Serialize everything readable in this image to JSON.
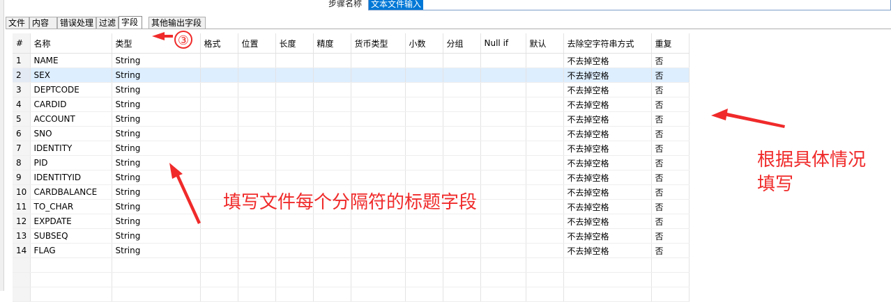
{
  "step": {
    "label": "步骤名称",
    "value": "文本文件输入"
  },
  "tabs": [
    "文件",
    "内容",
    "错误处理",
    "过滤",
    "字段",
    "其他输出字段"
  ],
  "active_tab": 4,
  "grid": {
    "headers": [
      "#",
      "名称",
      "类型",
      "格式",
      "位置",
      "长度",
      "精度",
      "货币类型",
      "小数",
      "分组",
      "Null if",
      "默认",
      "去除空字符串方式",
      "重复"
    ],
    "rows": [
      [
        "1",
        "NAME",
        "String",
        "不去掉空格",
        "否"
      ],
      [
        "2",
        "SEX",
        "String",
        "不去掉空格",
        "否"
      ],
      [
        "3",
        "DEPTCODE",
        "String",
        "不去掉空格",
        "否"
      ],
      [
        "4",
        "CARDID",
        "String",
        "不去掉空格",
        "否"
      ],
      [
        "5",
        "ACCOUNT",
        "String",
        "不去掉空格",
        "否"
      ],
      [
        "6",
        "SNO",
        "String",
        "不去掉空格",
        "否"
      ],
      [
        "7",
        "IDENTITY",
        "String",
        "不去掉空格",
        "否"
      ],
      [
        "8",
        "PID",
        "String",
        "不去掉空格",
        "否"
      ],
      [
        "9",
        "IDENTITYID",
        "String",
        "不去掉空格",
        "否"
      ],
      [
        "10",
        "CARDBALANCE",
        "String",
        "不去掉空格",
        "否"
      ],
      [
        "11",
        "TO_CHAR",
        "String",
        "不去掉空格",
        "否"
      ],
      [
        "12",
        "EXPDATE",
        "String",
        "不去掉空格",
        "否"
      ],
      [
        "13",
        "SUBSEQ",
        "String",
        "不去掉空格",
        "否"
      ],
      [
        "14",
        "FLAG",
        "String",
        "不去掉空格",
        "否"
      ]
    ],
    "selected_row": 1
  },
  "annotations": {
    "marker": "③",
    "note_fields": "填写文件每个分隔符的标题字段",
    "note_right_line1": "根据具体情况",
    "note_right_line2": "填写",
    "color": "#f02a2a"
  }
}
